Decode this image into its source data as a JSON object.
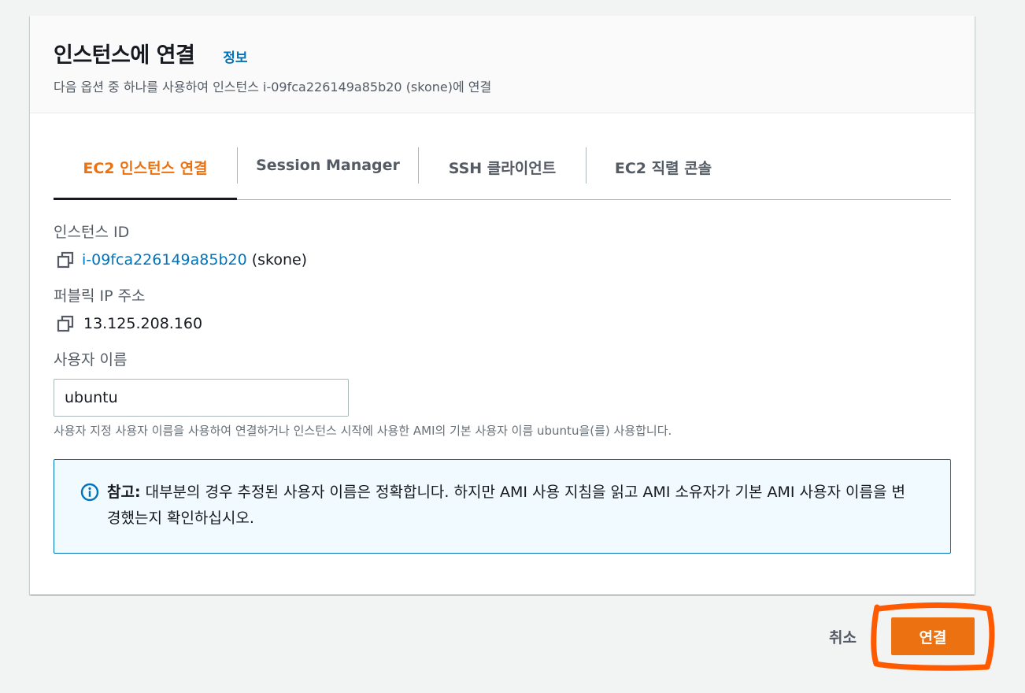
{
  "header": {
    "title": "인스턴스에 연결",
    "info_link": "정보",
    "subtitle": "다음 옵션 중 하나를 사용하여 인스턴스 i-09fca226149a85b20 (skone)에 연결"
  },
  "tabs": [
    {
      "label": "EC2 인스턴스 연결",
      "active": true
    },
    {
      "label": "Session Manager",
      "active": false
    },
    {
      "label": "SSH 클라이언트",
      "active": false
    },
    {
      "label": "EC2 직렬 콘솔",
      "active": false
    }
  ],
  "instance": {
    "label": "인스턴스 ID",
    "id": "i-09fca226149a85b20",
    "name": "(skone)"
  },
  "public_ip": {
    "label": "퍼블릭 IP 주소",
    "value": "13.125.208.160"
  },
  "username": {
    "label": "사용자 이름",
    "value": "ubuntu",
    "hint": "사용자 지정 사용자 이름을 사용하여 연결하거나 인스턴스 시작에 사용한 AMI의 기본 사용자 이름 ubuntu을(를) 사용합니다."
  },
  "alert": {
    "prefix": "참고:",
    "text": " 대부분의 경우 추정된 사용자 이름은 정확합니다. 하지만 AMI 사용 지침을 읽고 AMI 소유자가 기본 AMI 사용자 이름을 변경했는지 확인하십시오."
  },
  "footer": {
    "cancel_label": "취소",
    "connect_label": "연결"
  },
  "colors": {
    "accent": "#ec7211",
    "link": "#0073bb",
    "annotation": "#ff5a00"
  },
  "icons": {
    "copy": "copy-icon",
    "info": "info-circle-icon"
  }
}
